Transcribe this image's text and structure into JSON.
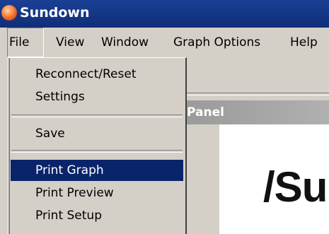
{
  "window": {
    "title": "Sundown",
    "icon": "app-logo-icon"
  },
  "menubar": {
    "items": [
      "File",
      "View",
      "Window",
      "Graph Options",
      "Help"
    ]
  },
  "file_menu": {
    "items": [
      "Reconnect/Reset",
      "Settings",
      "Save",
      "Print Graph",
      "Print Preview",
      "Print Setup"
    ],
    "highlighted": "Print Graph"
  },
  "panel": {
    "title": "Panel",
    "graph_text": "/Su"
  },
  "colors": {
    "titlebar": "#1a3f94",
    "highlight": "#0a246a",
    "window_bg": "#d4d0c8"
  }
}
